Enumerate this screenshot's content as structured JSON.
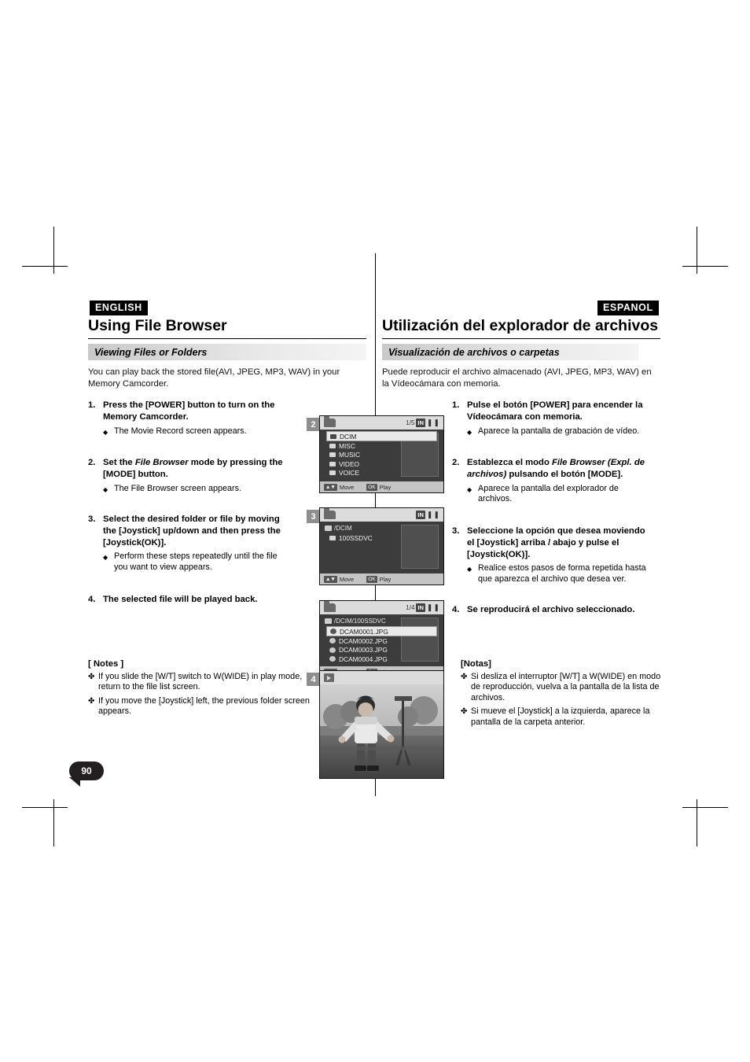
{
  "meta": {
    "page_number": "90"
  },
  "left": {
    "lang_tag": "ENGLISH",
    "title": "Using File Browser",
    "section": "Viewing Files or Folders",
    "intro": "You can play back the stored file(AVI, JPEG, MP3, WAV) in your Memory Camcorder.",
    "steps": [
      {
        "num": "1.",
        "text": "Press the [POWER] button to turn on the Memory Camcorder.",
        "bullets": [
          "The Movie Record screen appears."
        ]
      },
      {
        "num": "2.",
        "text_pre": "Set the ",
        "text_em": "File Browser",
        "text_post": " mode by pressing the [MODE] button.",
        "bullets": [
          "The File Browser screen appears."
        ]
      },
      {
        "num": "3.",
        "text": "Select the desired folder or file by moving the [Joystick] up/down and then press the [Joystick(OK)].",
        "bullets": [
          "Perform these steps repeatedly until the file you want to view appears."
        ]
      },
      {
        "num": "4.",
        "text": "The selected file will be played back.",
        "bullets": []
      }
    ],
    "notes_heading": "[ Notes ]",
    "notes": [
      "If you slide the [W/T] switch to W(WIDE) in play mode, return to the file list screen.",
      "If you move the [Joystick] left, the previous folder screen appears."
    ]
  },
  "right": {
    "lang_tag": "ESPANOL",
    "title": "Utilización del explorador de archivos",
    "section": "Visualización de archivos o carpetas",
    "intro": "Puede reproducir el archivo almacenado (AVI, JPEG, MP3, WAV) en la Vídeocámara con memoria.",
    "steps": [
      {
        "num": "1.",
        "text": "Pulse el botón [POWER] para encender la Vídeocámara con memoria.",
        "bullets": [
          "Aparece la pantalla de grabación de vídeo."
        ]
      },
      {
        "num": "2.",
        "text_pre": "Establezca el modo ",
        "text_em": "File Browser (Expl. de archivos)",
        "text_post": " pulsando el botón [MODE].",
        "bullets": [
          "Aparece la pantalla del explorador de archivos."
        ]
      },
      {
        "num": "3.",
        "text": "Seleccione la opción que desea moviendo el [Joystick] arriba / abajo y pulse el [Joystick(OK)].",
        "bullets": [
          "Realice estos pasos de forma repetida hasta que aparezca el archivo que desea ver."
        ]
      },
      {
        "num": "4.",
        "text": "Se reproducirá el archivo seleccionado.",
        "bullets": []
      }
    ],
    "notes_heading": "[Notas]",
    "notes": [
      "Si desliza el interruptor [W/T] a W(WIDE) en modo de reproducción, vuelva a la pantalla de la lista de archivos.",
      "Si mueve el [Joystick] a la izquierda, aparece la pantalla de la carpeta anterior."
    ]
  },
  "screens": [
    {
      "step_label": "2",
      "counter": "1/5",
      "in_badge": "IN",
      "rows": [
        {
          "label": "DCIM",
          "selected": true,
          "icon": "folder-icon"
        },
        {
          "label": "MISC",
          "selected": false,
          "icon": "folder-icon"
        },
        {
          "label": "MUSIC",
          "selected": false,
          "icon": "folder-icon"
        },
        {
          "label": "VIDEO",
          "selected": false,
          "icon": "folder-icon"
        },
        {
          "label": "VOICE",
          "selected": false,
          "icon": "folder-icon"
        }
      ],
      "btn_move": "Move",
      "btn_move_key": "▲▼",
      "btn_play": "Play",
      "btn_play_key": "OK"
    },
    {
      "step_label": "3",
      "counter": "",
      "in_badge": "IN",
      "path": "/DCIM",
      "rows": [
        {
          "label": "100SSDVC",
          "selected": false,
          "icon": "folder-icon"
        }
      ],
      "btn_move": "Move",
      "btn_move_key": "▲▼",
      "btn_play": "Play",
      "btn_play_key": "OK"
    },
    {
      "step_label": "",
      "counter": "1/4",
      "in_badge": "IN",
      "path": "/DCIM/100SSDVC",
      "rows": [
        {
          "label": "DCAM0001.JPG",
          "selected": true,
          "icon": "file-icon"
        },
        {
          "label": "DCAM0002.JPG",
          "selected": false,
          "icon": "file-icon"
        },
        {
          "label": "DCAM0003.JPG",
          "selected": false,
          "icon": "file-icon"
        },
        {
          "label": "DCAM0004.JPG",
          "selected": false,
          "icon": "file-icon"
        }
      ],
      "btn_move": "Move",
      "btn_move_key": "▲▼",
      "btn_play": "Play",
      "btn_play_key": "OK"
    }
  ],
  "photo_screen": {
    "step_label": "4"
  }
}
